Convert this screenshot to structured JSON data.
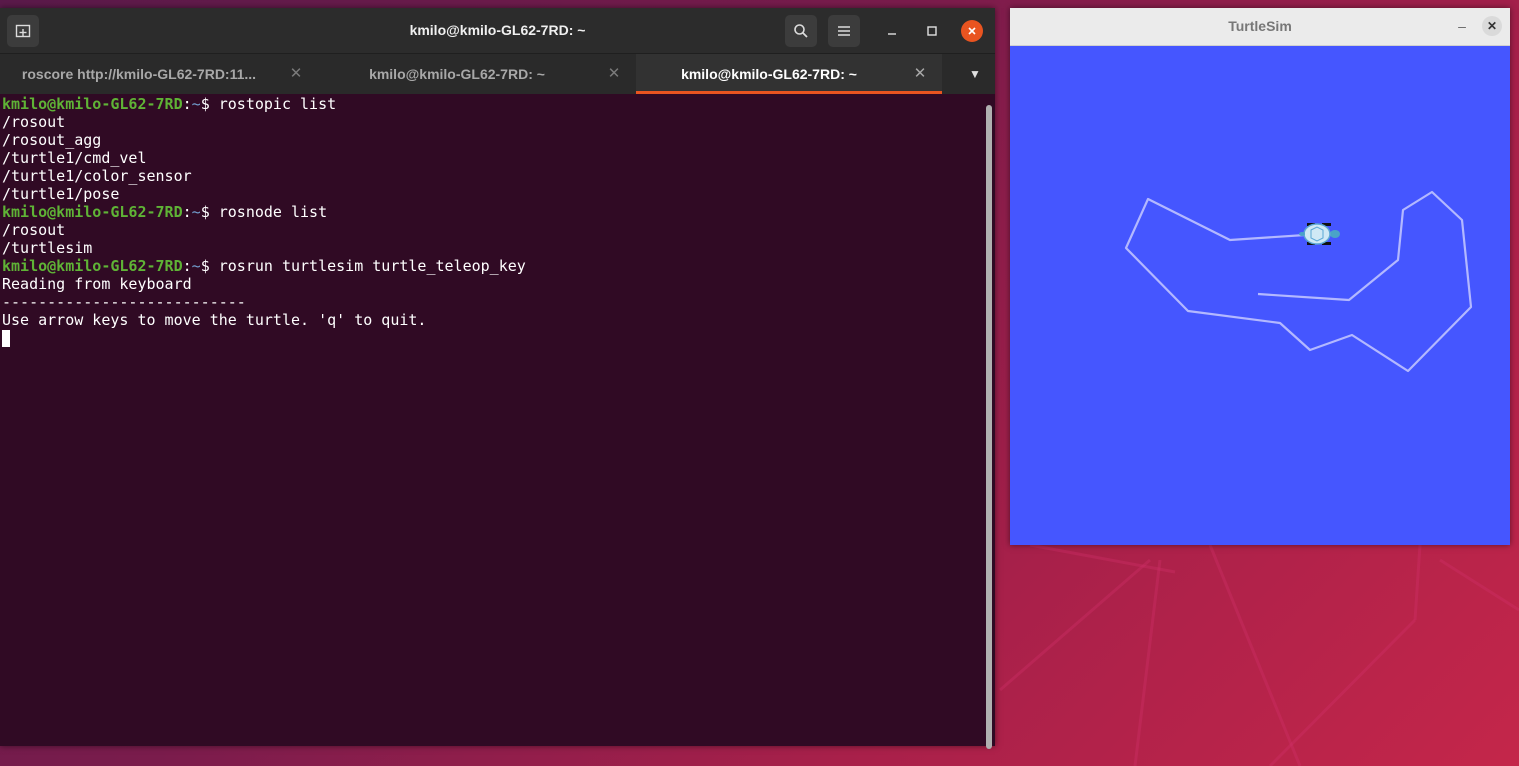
{
  "terminal": {
    "title": "kmilo@kmilo-GL62-7RD: ~",
    "tabs": [
      {
        "label": "roscore http://kmilo-GL62-7RD:11...",
        "active": false
      },
      {
        "label": "kmilo@kmilo-GL62-7RD: ~",
        "active": false
      },
      {
        "label": "kmilo@kmilo-GL62-7RD: ~",
        "active": true
      }
    ],
    "prompt": {
      "user": "kmilo@kmilo-GL62-7RD",
      "sep": ":",
      "path": "~",
      "symbol": "$ "
    },
    "lines": [
      {
        "type": "cmd",
        "text": "rostopic list"
      },
      {
        "type": "out",
        "text": "/rosout"
      },
      {
        "type": "out",
        "text": "/rosout_agg"
      },
      {
        "type": "out",
        "text": "/turtle1/cmd_vel"
      },
      {
        "type": "out",
        "text": "/turtle1/color_sensor"
      },
      {
        "type": "out",
        "text": "/turtle1/pose"
      },
      {
        "type": "cmd",
        "text": "rosnode list"
      },
      {
        "type": "out",
        "text": "/rosout"
      },
      {
        "type": "out",
        "text": "/turtlesim"
      },
      {
        "type": "cmd",
        "text": "rosrun turtlesim turtle_teleop_key"
      },
      {
        "type": "out",
        "text": "Reading from keyboard"
      },
      {
        "type": "out",
        "text": "---------------------------"
      },
      {
        "type": "out",
        "text": "Use arrow keys to move the turtle. 'q' to quit."
      }
    ],
    "icons": {
      "new_tab": "new-tab-icon",
      "search": "search-icon",
      "menu": "hamburger-menu-icon",
      "minimize": "minimize-icon",
      "maximize": "maximize-icon",
      "close": "close-icon",
      "tab_dropdown": "chevron-down-icon"
    }
  },
  "turtlesim": {
    "title": "TurtleSim",
    "background_color": "#4556ff",
    "trail_color": "#b3b8ff"
  }
}
